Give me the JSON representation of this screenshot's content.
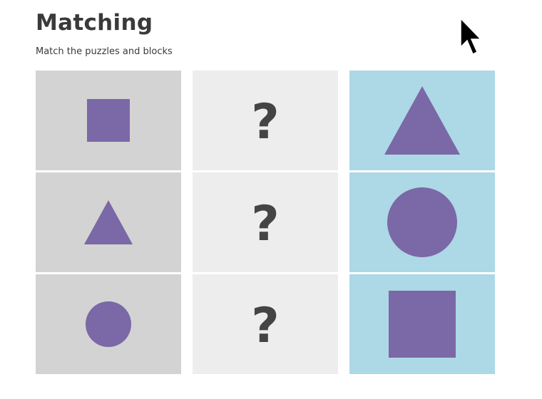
{
  "header": {
    "title": "Matching",
    "subtitle": "Match the puzzles and blocks"
  },
  "colors": {
    "shape": "#7b68a6",
    "puzzle_bg": "#d3d3d3",
    "answer_bg": "#ededed",
    "block_bg": "#add8e6",
    "question_mark": "#444444"
  },
  "puzzles": [
    {
      "shape": "square-icon"
    },
    {
      "shape": "triangle-icon"
    },
    {
      "shape": "circle-icon"
    }
  ],
  "answers": [
    {
      "label": "?"
    },
    {
      "label": "?"
    },
    {
      "label": "?"
    }
  ],
  "blocks": [
    {
      "shape": "triangle-icon"
    },
    {
      "shape": "circle-icon"
    },
    {
      "shape": "square-icon"
    }
  ]
}
